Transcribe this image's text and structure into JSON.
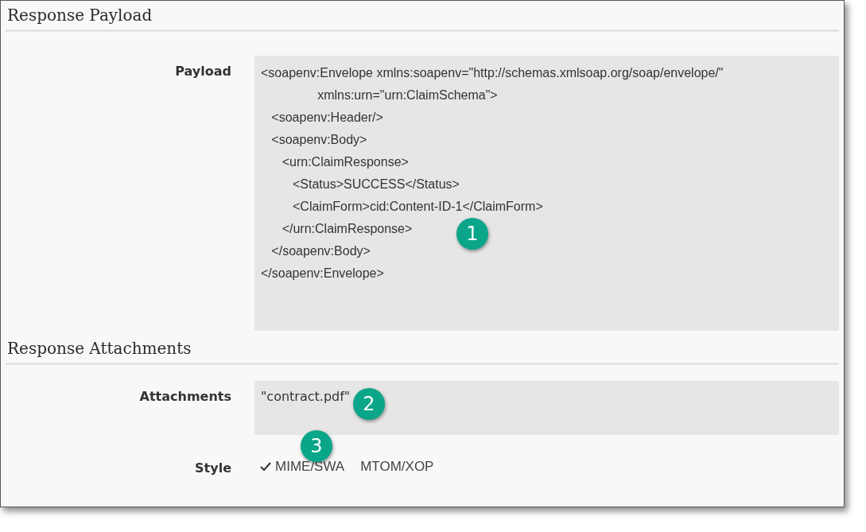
{
  "sections": [
    {
      "title": "Response Payload",
      "fields": [
        {
          "kind": "code",
          "label": "Payload",
          "value": "<soapenv:Envelope xmlns:soapenv=\"http://schemas.xmlsoap.org/soap/envelope/\"\n                xmlns:urn=\"urn:ClaimSchema\">\n   <soapenv:Header/>\n   <soapenv:Body>\n      <urn:ClaimResponse>\n         <Status>SUCCESS</Status>\n         <ClaimForm>cid:Content-ID-1</ClaimForm>\n      </urn:ClaimResponse>\n   </soapenv:Body>\n</soapenv:Envelope>"
        }
      ]
    },
    {
      "title": "Response Attachments",
      "fields": [
        {
          "kind": "text",
          "label": "Attachments",
          "value": "\"contract.pdf\""
        },
        {
          "kind": "options",
          "label": "Style",
          "options": [
            {
              "label": "MIME/SWA",
              "selected": true
            },
            {
              "label": "MTOM/XOP",
              "selected": false
            }
          ]
        }
      ]
    }
  ],
  "callouts": [
    "1",
    "2",
    "3"
  ]
}
